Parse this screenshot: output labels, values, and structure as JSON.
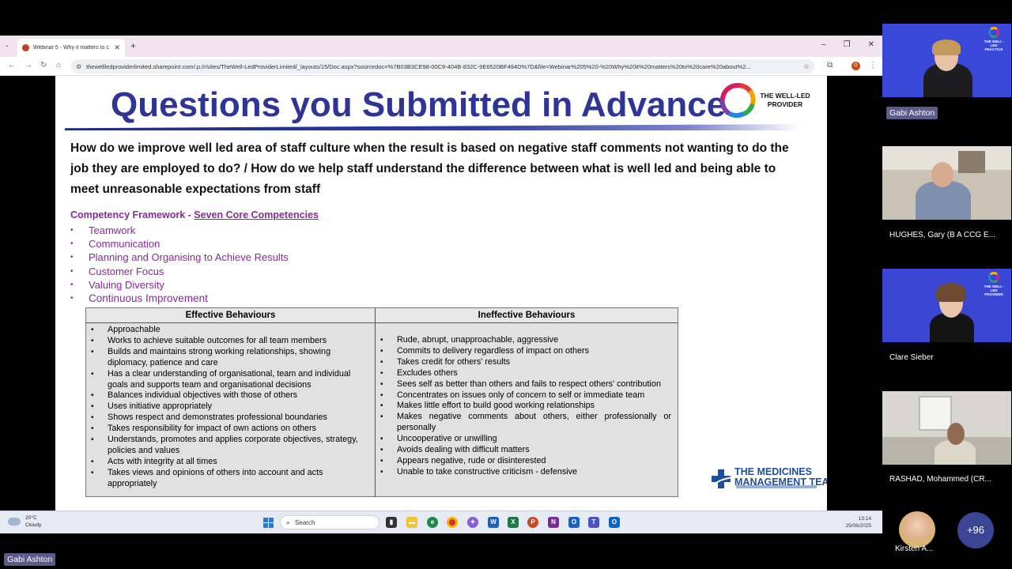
{
  "browser": {
    "tab_title": "Webinar 5 - Why it matters to c",
    "url": "thewellledproviderlimited.sharepoint.com/:p:/r/sites/TheWell-LedProviderLimited/_layouts/15/Doc.aspx?sourcedoc=%7B03B3CE98-00C9-404B-832C-9E6520BF494D%7D&file=Webinar%205%20-%20Why%20it%20matters%20to%20care%20about%2...",
    "profile_initial": "G"
  },
  "slide": {
    "title": "Questions you Submitted in Advance",
    "logo_text": "THE WELL-LED PROVIDER",
    "question": "How do we improve well led area of staff  culture when the result is based on negative staff comments not wanting to do the job they are employed to do? / How do we help staff understand the difference between what is well led and being able to meet unreasonable expectations from staff",
    "competency_heading_prefix": "Competency Framework - ",
    "competency_heading_link": "Seven Core Competencies",
    "competencies": [
      "Teamwork",
      "Communication",
      "Planning and Organising to Achieve Results",
      "Customer Focus",
      "Valuing Diversity",
      "Continuous Improvement"
    ],
    "table": {
      "effective_header": "Effective Behaviours",
      "ineffective_header": "Ineffective Behaviours",
      "effective": [
        "Approachable",
        "Works to achieve suitable outcomes for all team members",
        "Builds and maintains strong working relationships, showing diplomacy, patience and care",
        "Has a clear understanding of organisational, team and individual goals and supports team and organisational decisions",
        "Balances individual objectives with those of others",
        "Uses initiative appropriately",
        "Shows respect and demonstrates professional boundaries",
        "Takes responsibility for impact of own actions on others",
        "Understands, promotes and applies corporate objectives, strategy, policies and values",
        "Acts with integrity at all times",
        "Takes views and opinions of others into account and acts appropriately"
      ],
      "ineffective": [
        "Rude, abrupt, unapproachable, aggressive",
        "Commits to delivery regardless of impact on others",
        "Takes credit for others' results",
        "Excludes others",
        "Sees self as better than others and fails to respect others' contribution",
        "Concentrates on issues only of concern to self or immediate team",
        "Makes little effort to build good working relationships",
        "Makes negative comments about others, either professionally or personally",
        "Uncooperative or unwilling",
        "Avoids dealing with difficult matters",
        "Appears negative, rude or disinterested",
        "Unable to take constructive criticism - defensive"
      ]
    },
    "mmt_logo_line1": "THE MEDICINES",
    "mmt_logo_line2": "MANAGEMENT TEAM"
  },
  "taskbar": {
    "weather_temp": "20°C",
    "weather_desc": "Cloudy",
    "search_placeholder": "Search",
    "time": "13:14",
    "date": "25/06/2025"
  },
  "participants": {
    "tile1_badge": "Gabi Ashton",
    "tile1_logo": "THE WELL-LED PRACTICE",
    "tile2_name": "HUGHES, Gary (B A CCG E...",
    "tile3_name": "Clare Sieber",
    "tile3_logo": "THE WELL-LED PROVIDER",
    "tile4_name": "RASHAD, Mohammed (CR...",
    "kirsten_name": "Kirsten A...",
    "more_count": "+96",
    "speaker_badge": "Gabi Ashton"
  }
}
